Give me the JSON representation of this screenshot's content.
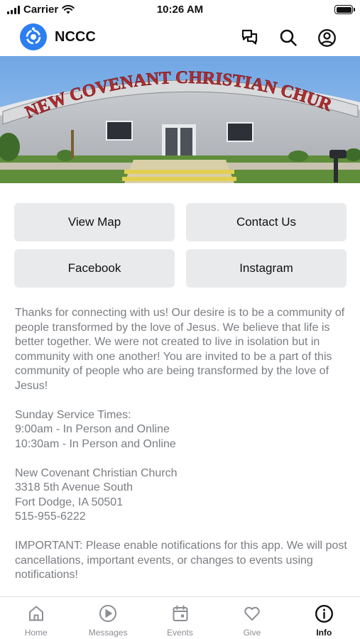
{
  "status_bar": {
    "carrier": "Carrier",
    "time": "10:26 AM"
  },
  "header": {
    "title": "NCCC",
    "icons": [
      "logo-icon",
      "chat-icon",
      "search-icon",
      "profile-icon"
    ]
  },
  "hero": {
    "sign_text": "NEW COVENANT CHRISTIAN CHURCH"
  },
  "buttons": {
    "view_map": "View Map",
    "contact_us": "Contact Us",
    "facebook": "Facebook",
    "instagram": "Instagram"
  },
  "info": {
    "welcome": "Thanks for connecting with us! Our desire is to be a community of people transformed by the love of Jesus. We believe that life is better together. We were not created to live in isolation but in community with one another! You are invited to be a part of this community of people who are being transformed by the love of Jesus!",
    "service_times": {
      "heading": "Sunday Service Times:",
      "times": [
        "9:00am - In Person and Online",
        "10:30am - In Person and Online"
      ]
    },
    "address": {
      "name": "New Covenant Christian Church",
      "street": "3318 5th Avenue South",
      "city": "Fort Dodge, IA 50501",
      "phone": "515-955-6222"
    },
    "notice": "IMPORTANT: Please enable notifications for this app. We will post cancellations, important events, or changes to events using notifications!"
  },
  "tabs": [
    {
      "label": "Home",
      "icon": "home-icon"
    },
    {
      "label": "Messages",
      "icon": "play-icon"
    },
    {
      "label": "Events",
      "icon": "calendar-icon"
    },
    {
      "label": "Give",
      "icon": "heart-icon"
    },
    {
      "label": "Info",
      "icon": "info-icon"
    }
  ],
  "colors": {
    "accent": "#2d7ff0",
    "button_bg": "#e9eaec",
    "body_text": "#7a7d82",
    "sign_red": "#b52b2e"
  }
}
